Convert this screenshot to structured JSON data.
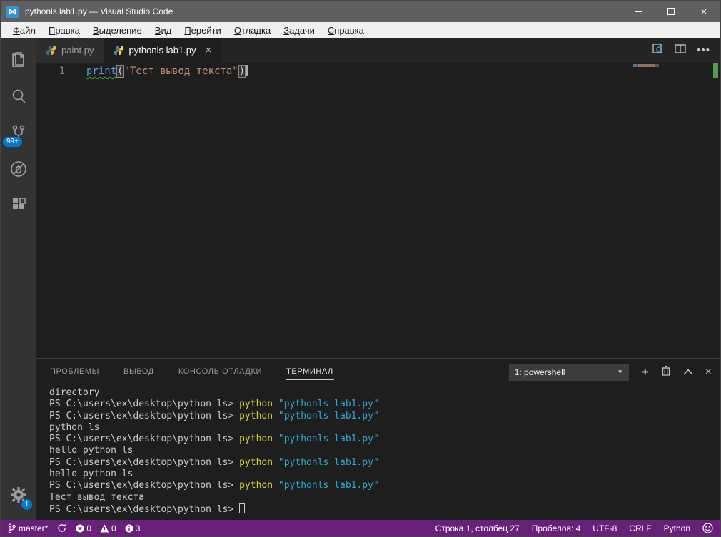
{
  "window": {
    "title": "pythonls lab1.py — Visual Studio Code"
  },
  "menu": {
    "items": [
      "Файл",
      "Правка",
      "Выделение",
      "Вид",
      "Перейти",
      "Отладка",
      "Задачи",
      "Справка"
    ]
  },
  "activity_bar": {
    "items": [
      "explorer",
      "search",
      "source-control",
      "debug",
      "extensions"
    ],
    "source_control_badge": "99+",
    "settings_badge": "1"
  },
  "tabs": [
    {
      "label": "paint.py",
      "active": false
    },
    {
      "label": "pythonls lab1.py",
      "active": true
    }
  ],
  "editor": {
    "line_number": "1",
    "code_segments": [
      {
        "text": "print",
        "style": "function"
      },
      {
        "text": "(",
        "style": "bracket"
      },
      {
        "text": "\"Тест вывод текста\"",
        "style": "string"
      },
      {
        "text": ")",
        "style": "bracket"
      }
    ]
  },
  "panel": {
    "tabs": [
      "ПРОБЛЕМЫ",
      "ВЫВОД",
      "КОНСОЛЬ ОТЛАДКИ",
      "ТЕРМИНАЛ"
    ],
    "active_tab": "ТЕРМИНАЛ",
    "terminal_select": "1: powershell"
  },
  "terminal": {
    "lines": [
      {
        "segments": [
          {
            "text": "directory",
            "style": "p"
          }
        ]
      },
      {
        "segments": [
          {
            "text": "PS C:\\users\\ex\\desktop\\python ls> ",
            "style": "p"
          },
          {
            "text": "python ",
            "style": "c"
          },
          {
            "text": "\"pythonls lab1.py\"",
            "style": "s"
          }
        ]
      },
      {
        "segments": [
          {
            "text": "PS C:\\users\\ex\\desktop\\python ls> ",
            "style": "p"
          },
          {
            "text": "python ",
            "style": "c"
          },
          {
            "text": "\"pythonls lab1.py\"",
            "style": "s"
          }
        ]
      },
      {
        "segments": [
          {
            "text": "python ls",
            "style": "p"
          }
        ]
      },
      {
        "segments": [
          {
            "text": "PS C:\\users\\ex\\desktop\\python ls> ",
            "style": "p"
          },
          {
            "text": "python ",
            "style": "c"
          },
          {
            "text": "\"pythonls lab1.py\"",
            "style": "s"
          }
        ]
      },
      {
        "segments": [
          {
            "text": "hello python ls",
            "style": "p"
          }
        ]
      },
      {
        "segments": [
          {
            "text": "PS C:\\users\\ex\\desktop\\python ls> ",
            "style": "p"
          },
          {
            "text": "python ",
            "style": "c"
          },
          {
            "text": "\"pythonls lab1.py\"",
            "style": "s"
          }
        ]
      },
      {
        "segments": [
          {
            "text": "hello python ls",
            "style": "p"
          }
        ]
      },
      {
        "segments": [
          {
            "text": "PS C:\\users\\ex\\desktop\\python ls> ",
            "style": "p"
          },
          {
            "text": "python ",
            "style": "c"
          },
          {
            "text": "\"pythonls lab1.py\"",
            "style": "s"
          }
        ]
      },
      {
        "segments": [
          {
            "text": "Тест вывод текста",
            "style": "p"
          }
        ]
      },
      {
        "segments": [
          {
            "text": "PS C:\\users\\ex\\desktop\\python ls> ",
            "style": "p"
          }
        ],
        "cursor": true
      }
    ]
  },
  "status_bar": {
    "branch": "master*",
    "errors": "0",
    "warnings": "0",
    "infos": "3",
    "line_col": "Строка 1, столбец 27",
    "spaces": "Пробелов: 4",
    "encoding": "UTF-8",
    "eol": "CRLF",
    "language": "Python"
  },
  "colors": {
    "status_bar": "#68217a",
    "badge": "#007acc",
    "activity_bar": "#333333",
    "editor_bg": "#1e1e1e",
    "tab_bar": "#252526",
    "inactive_tab": "#2d2d2d",
    "keyword": "#569cd6",
    "string": "#ce9178",
    "terminal_command": "#d6d62d",
    "terminal_string": "#2aa9d2",
    "title_bar": "#5f5f5f"
  }
}
